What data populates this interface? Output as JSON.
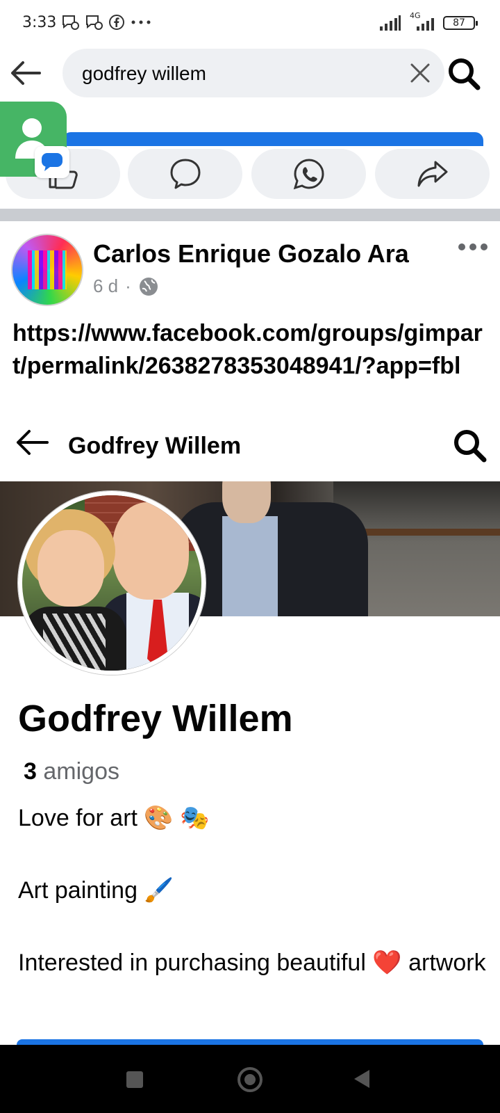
{
  "status_bar": {
    "time": "3:33",
    "network_label": "4G",
    "battery": "87"
  },
  "search": {
    "query": "godfrey willem"
  },
  "post": {
    "author": "Carlos Enrique Gozalo Ara",
    "time": "6 d",
    "separator": "·",
    "link": "https://www.facebook.com/groups/gimpart/permalink/2638278353048941/?app=fbl"
  },
  "profile_header": {
    "title": "Godfrey Willem"
  },
  "profile": {
    "name": "Godfrey Willem",
    "friends_count": "3",
    "friends_label": "amigos",
    "bio": {
      "line1": "Love for art 🎨 🎭",
      "line2": "Art painting 🖌️",
      "line3": "Interested in purchasing beautiful ❤️ artwork"
    }
  },
  "colors": {
    "accent": "#1b74e4",
    "chat_head": "#46b565",
    "pill": "#eef0f3"
  }
}
